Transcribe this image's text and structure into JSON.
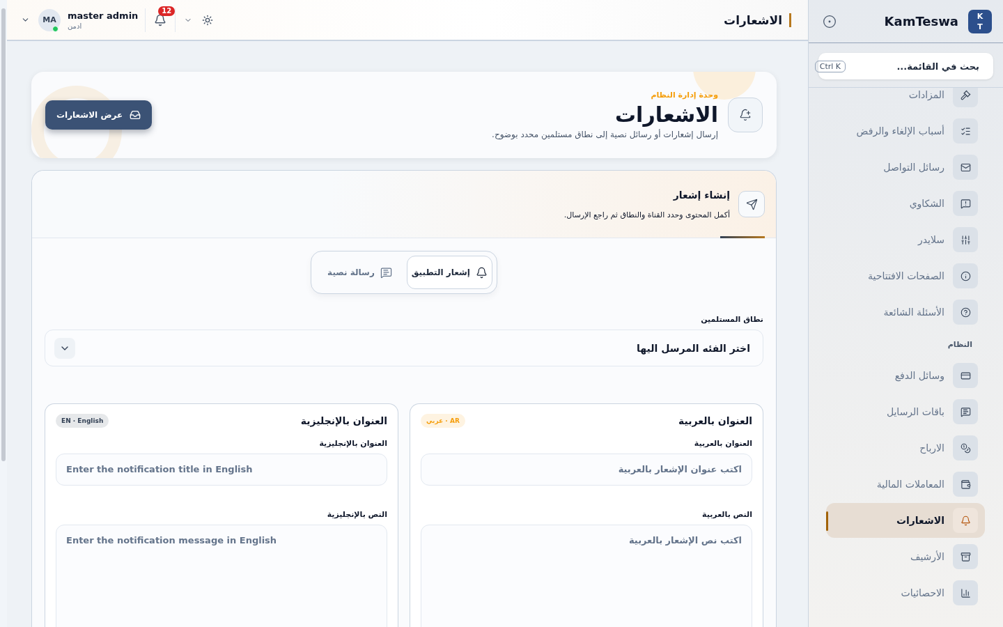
{
  "header": {
    "page_title": "الاشعارات",
    "notifications": {
      "count": "12"
    },
    "user": {
      "name": "master admin",
      "role": "ادمن",
      "initials": "MA",
      "online": true
    }
  },
  "sidebar": {
    "brand": {
      "name": "KamTeswa",
      "logo_letters": [
        "K",
        "T"
      ]
    },
    "search": {
      "placeholder": "بحث في القائمة...",
      "shortcut": "Ctrl K"
    },
    "groups": [
      {
        "items": [
          {
            "label": "المزادات",
            "selected": false
          },
          {
            "label": "أسباب الإلغاء والرفض",
            "selected": false
          },
          {
            "label": "رسائل التواصل",
            "selected": false
          },
          {
            "label": "الشكاوي",
            "selected": false
          },
          {
            "label": "سلايدر",
            "selected": false
          },
          {
            "label": "الصفحات الافتتاحية",
            "selected": false
          },
          {
            "label": "الأسئلة الشائعة",
            "selected": false
          }
        ]
      },
      {
        "title": "النظام",
        "items": [
          {
            "label": "وسائل الدفع",
            "selected": false
          },
          {
            "label": "باقات الرسايل",
            "selected": false
          },
          {
            "label": "الارباح",
            "selected": false
          },
          {
            "label": "المعاملات المالية",
            "selected": false
          },
          {
            "label": "الاشعارات",
            "selected": true
          },
          {
            "label": "الأرشيف",
            "selected": false
          },
          {
            "label": "الاحصائيات",
            "selected": false
          }
        ]
      }
    ]
  },
  "hero": {
    "eyebrow": "وحدة إدارة النظام",
    "title": "الاشعارات",
    "description": "إرسال إشعارات أو رسائل نصية إلى نطاق مستلمين محدد بوضوح.",
    "action": "عرض الاشعارات"
  },
  "composer": {
    "title": "إنشاء إشعار",
    "subtitle": "أكمل المحتوى وحدد القناة والنطاق ثم راجع الإرسال.",
    "channels": [
      {
        "label": "إشعار التطبيق",
        "selected": true
      },
      {
        "label": "رسالة نصية",
        "selected": false
      }
    ],
    "scope": {
      "label": "نطاق المستلمين",
      "placeholder": "اختر الفئه المرسل اليها"
    },
    "languages": [
      {
        "title": "العنوان بالعربية",
        "badge": "AR · عربي",
        "color": "#f59e0b",
        "title_field": {
          "label": "العنوان بالعربية",
          "placeholder": "اكتب عنوان الإشعار بالعربية"
        },
        "body_field": {
          "label": "النص بالعربية",
          "placeholder": "اكتب نص الإشعار بالعربية"
        }
      },
      {
        "title": "العنوان بالإنجليزية",
        "badge": "EN · English",
        "color": "#334155",
        "title_field": {
          "label": "العنوان بالإنجليزية",
          "placeholder": "Enter the notification title in English"
        },
        "body_field": {
          "label": "النص بالإنجليزية",
          "placeholder": "Enter the notification message in English"
        }
      }
    ]
  }
}
